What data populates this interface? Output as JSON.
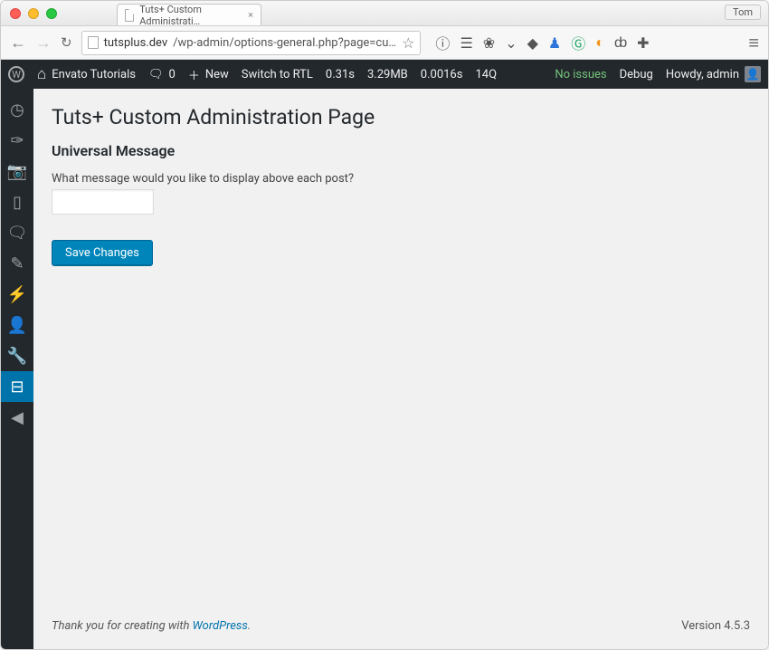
{
  "window": {
    "profile": "Tom",
    "tab_title": "Tuts+ Custom Administrati…"
  },
  "browser": {
    "host": "tutsplus.dev",
    "path": "/wp-admin/options-general.php?page=cu…"
  },
  "adminbar": {
    "site_name": "Envato Tutorials",
    "comments": "0",
    "new_label": "New",
    "rtl_label": "Switch to RTL",
    "timing": "0.31s",
    "memory": "3.29MB",
    "dbtime": "0.0016s",
    "queries": "14Q",
    "noissues": "No issues",
    "debug": "Debug",
    "howdy": "Howdy, admin"
  },
  "page": {
    "title": "Tuts+ Custom Administration Page",
    "section": "Universal Message",
    "description": "What message would you like to display above each post?",
    "input_value": "",
    "save_label": "Save Changes"
  },
  "footer": {
    "thanks_prefix": "Thank you for creating with ",
    "thanks_link": "WordPress",
    "thanks_suffix": ".",
    "version": "Version 4.5.3"
  }
}
